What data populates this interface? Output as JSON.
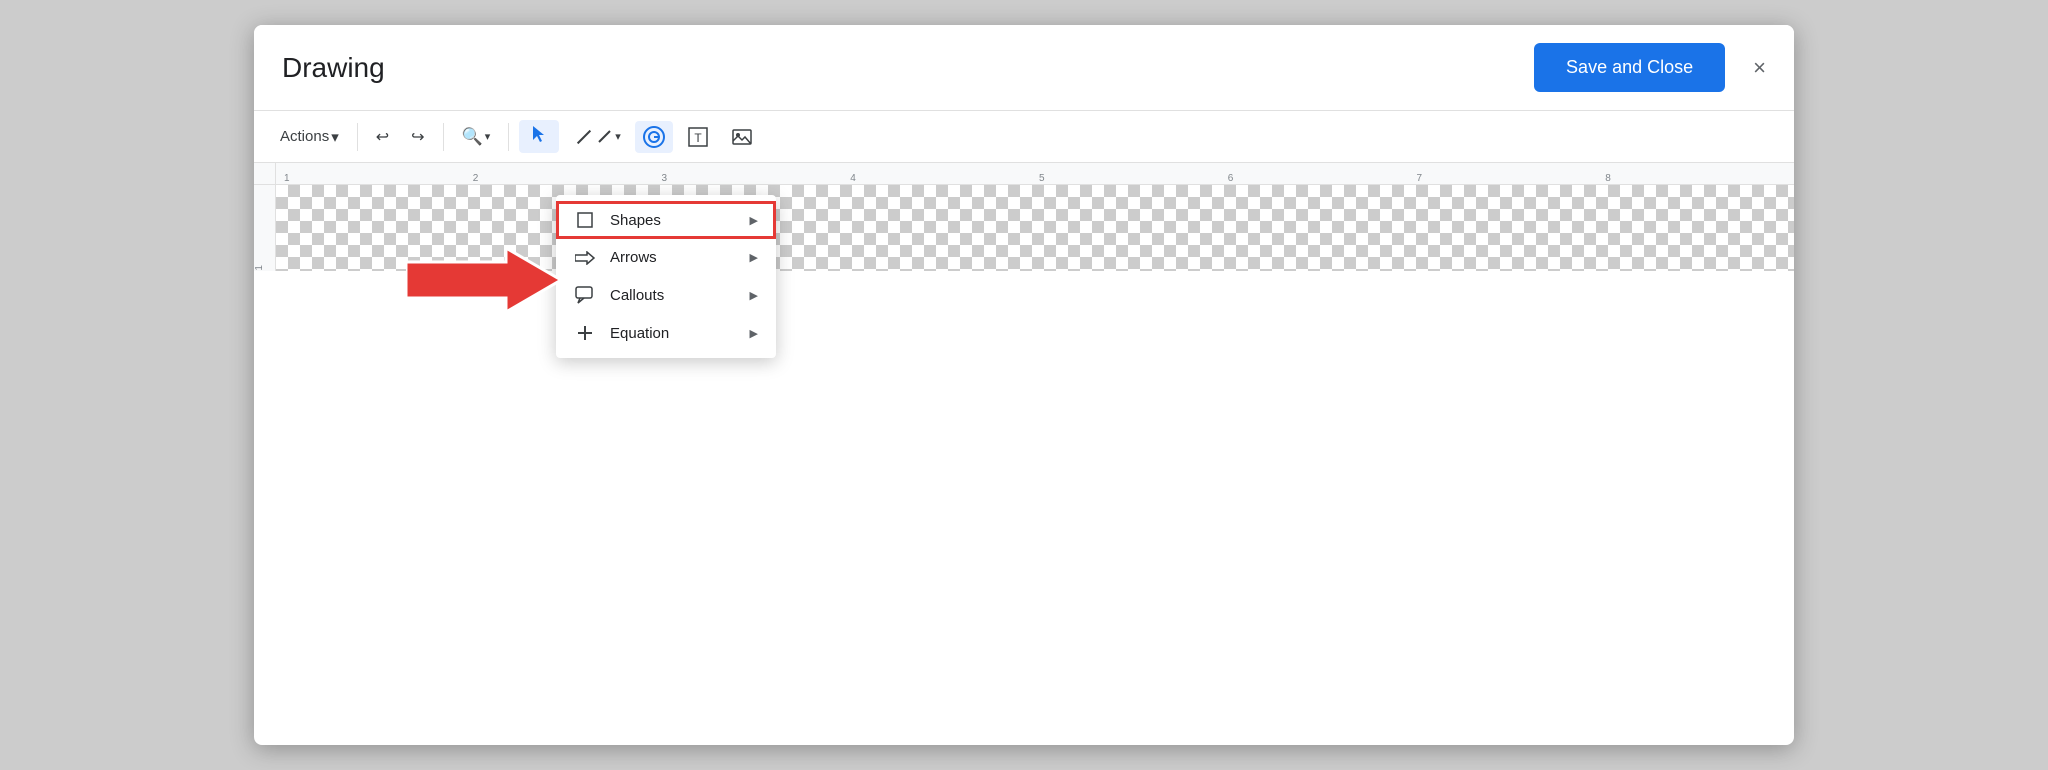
{
  "header": {
    "title": "Drawing",
    "save_close_label": "Save and Close",
    "close_icon": "×"
  },
  "toolbar": {
    "actions_label": "Actions",
    "actions_arrow": "▾",
    "undo_icon": "↩",
    "redo_icon": "↪",
    "zoom_icon": "🔍",
    "zoom_arrow": "▾",
    "select_icon": "▲",
    "line_icon": "╱",
    "line_arrow": "▾",
    "shapes_icon": "◯",
    "text_icon": "T",
    "image_icon": "⬚"
  },
  "ruler": {
    "marks": [
      "1",
      "2",
      "3",
      "4",
      "5",
      "6",
      "7",
      "8"
    ]
  },
  "dropdown": {
    "items": [
      {
        "id": "shapes",
        "label": "Shapes",
        "has_submenu": true,
        "highlighted": true
      },
      {
        "id": "arrows",
        "label": "Arrows",
        "has_submenu": true,
        "highlighted": false
      },
      {
        "id": "callouts",
        "label": "Callouts",
        "has_submenu": true,
        "highlighted": false
      },
      {
        "id": "equation",
        "label": "Equation",
        "has_submenu": true,
        "highlighted": false
      }
    ]
  },
  "colors": {
    "accent_blue": "#1a73e8",
    "highlight_red": "#e53935",
    "text_primary": "#202124",
    "text_secondary": "#5f6368"
  }
}
